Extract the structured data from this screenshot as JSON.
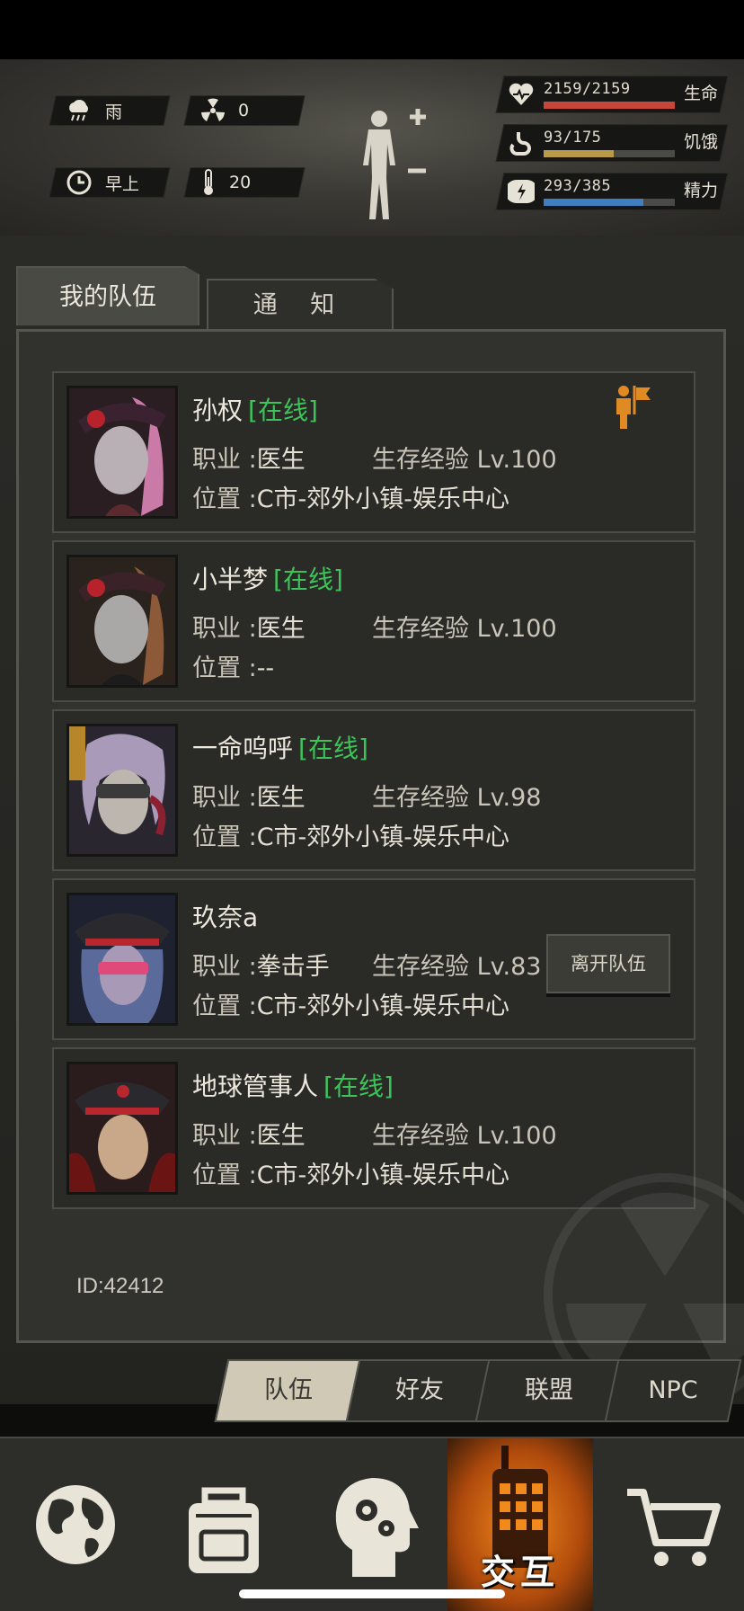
{
  "hud": {
    "weather": "雨",
    "radiation": "0",
    "time_of_day": "早上",
    "temperature": "20",
    "stats": [
      {
        "icon": "heart-icon",
        "value": "2159/2159",
        "label": "生命",
        "fraction": 1.0,
        "color": "#c8453a"
      },
      {
        "icon": "stomach-icon",
        "value": "93/175",
        "label": "饥饿",
        "fraction": 0.531,
        "color": "#b89a48"
      },
      {
        "icon": "energy-icon",
        "value": "293/385",
        "label": "精力",
        "fraction": 0.761,
        "color": "#3f7ec0"
      }
    ]
  },
  "tabs": {
    "my_team": "我的队伍",
    "notice": "通 知"
  },
  "labels": {
    "job": "职业",
    "exp": "生存经验",
    "location": "位置",
    "leave_team": "离开队伍"
  },
  "members": [
    {
      "name": "孙权",
      "online": "[在线]",
      "job": "医生",
      "level": "Lv.100",
      "location": "C市-郊外小镇-娱乐中心",
      "leader": true
    },
    {
      "name": "小半梦",
      "online": "[在线]",
      "job": "医生",
      "level": "Lv.100",
      "location": "--",
      "leader": false
    },
    {
      "name": "一命呜呼",
      "online": "[在线]",
      "job": "医生",
      "level": "Lv.98",
      "location": "C市-郊外小镇-娱乐中心",
      "leader": false
    },
    {
      "name": "玖奈a",
      "online": "",
      "job": "拳击手",
      "level": "Lv.83",
      "location": "C市-郊外小镇-娱乐中心",
      "leader": false
    },
    {
      "name": "地球管事人",
      "online": "[在线]",
      "job": "医生",
      "level": "Lv.100",
      "location": "C市-郊外小镇-娱乐中心",
      "leader": false
    }
  ],
  "id_text": "ID:42412",
  "subtabs": [
    "队伍",
    "好友",
    "联盟",
    "NPC"
  ],
  "nav": {
    "active_label": "交互"
  },
  "colors": {
    "online": "#3dc35a",
    "accent": "#f08a1d",
    "leader": "#e08a24"
  }
}
